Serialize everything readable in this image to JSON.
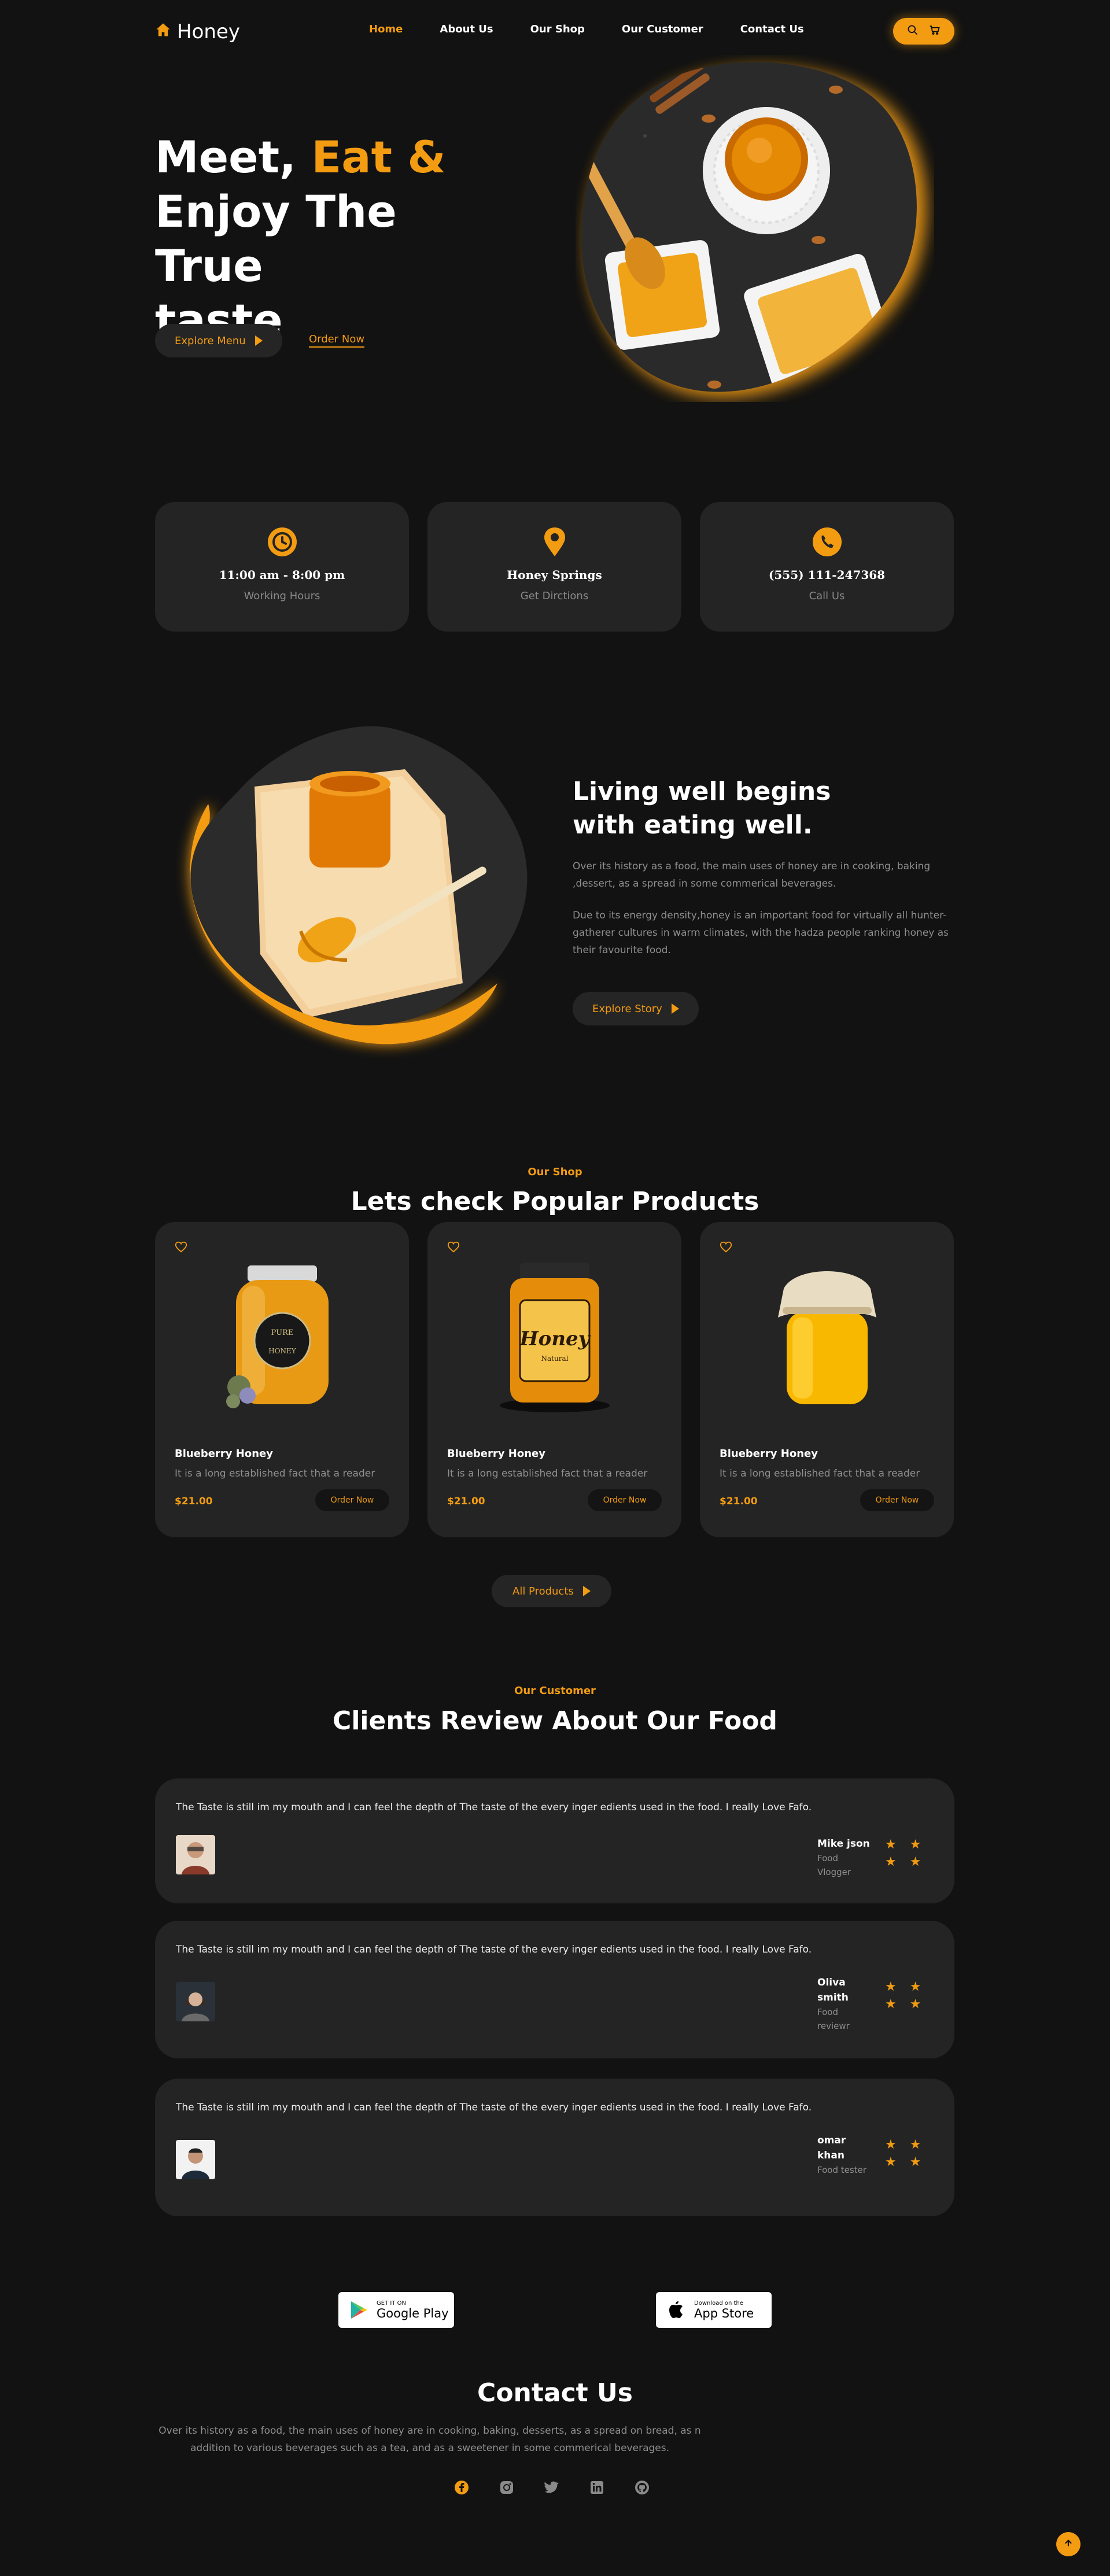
{
  "brand": {
    "name": "Honey",
    "accent": "#f39c12",
    "background": "#121212",
    "card": "#242424"
  },
  "nav": {
    "items": [
      {
        "label": "Home",
        "active": true
      },
      {
        "label": "About Us"
      },
      {
        "label": "Our Shop"
      },
      {
        "label": "Our Customer"
      },
      {
        "label": "Contact Us"
      }
    ],
    "icons": [
      "search-icon",
      "cart-icon"
    ]
  },
  "hero": {
    "title_line1_a": "Meet, ",
    "title_line1_b": "Eat &",
    "title_line2": "Enjoy The True",
    "title_line3": "taste",
    "primary_button": "Explore Menu",
    "secondary_link": "Order Now"
  },
  "info_cards": [
    {
      "icon": "clock-icon",
      "title": "11:00 am - 8:00 pm",
      "subtitle": "Working Hours"
    },
    {
      "icon": "location-pin-icon",
      "title": "Honey Springs",
      "subtitle": "Get Dirctions"
    },
    {
      "icon": "phone-icon",
      "title": "(555) 111-247368",
      "subtitle": "Call Us"
    }
  ],
  "about": {
    "title_line1": "Living well begins",
    "title_line2": "with eating well.",
    "paragraph1": "Over its history as a food, the main uses of honey are in cooking, baking ,dessert, as a spread in some commerical beverages.",
    "paragraph2": "Due to its energy density,honey is an important food for virtually all hunter-gatherer cultures in warm climates, with the hadza people ranking honey as their favourite food.",
    "button": "Explore Story"
  },
  "shop": {
    "kicker": "Our Shop",
    "title": "Lets check Popular Products",
    "products": [
      {
        "name": "Blueberry Honey",
        "desc": "It is a long established fact that a reader",
        "price": "$21.00",
        "button": "Order Now"
      },
      {
        "name": "Blueberry Honey",
        "desc": "It is a long established fact that a reader",
        "price": "$21.00",
        "button": "Order Now"
      },
      {
        "name": "Blueberry Honey",
        "desc": "It is a long established fact that a reader",
        "price": "$21.00",
        "button": "Order Now"
      }
    ],
    "jar_labels": {
      "jar1_top": "PURE",
      "jar1_bottom": "HONEY",
      "jar2_main": "Honey",
      "jar2_sub": "Natural"
    },
    "all_button": "All Products"
  },
  "reviews": {
    "kicker": "Our Customer",
    "title": "Clients Review About Our Food",
    "items": [
      {
        "text": "The Taste is still im my mouth and I can feel the depth of The taste of the every inger edients used in the food. I really Love Fafo.",
        "name": "Mike json",
        "role": "Food Vlogger",
        "stars": "★ ★ ★ ★"
      },
      {
        "text": "The Taste is still im my mouth and I can feel the depth of The taste of the every inger edients used in the food. I really Love Fafo.",
        "name": "Oliva smith",
        "role": "Food reviewr",
        "stars": "★ ★ ★ ★"
      },
      {
        "text": "The Taste is still im my mouth and I can feel the depth of The taste of the every inger edients used in the food. I really Love Fafo.",
        "name": "omar khan",
        "role": "Food tester",
        "stars": "★ ★ ★ ★"
      }
    ]
  },
  "stores": {
    "google": {
      "small": "GET IT ON",
      "big": "Google Play"
    },
    "apple": {
      "small": "Download on the",
      "big": "App Store"
    }
  },
  "contact": {
    "title": "Contact Us",
    "paragraph": "Over its history as a food, the main uses of honey are in cooking, baking, desserts, as a spread on bread, as n addition to various beverages such as a tea, and as a sweetener in some commerical beverages.",
    "socials": [
      "facebook-icon",
      "instagram-icon",
      "twitter-icon",
      "linkedin-icon",
      "github-icon"
    ]
  }
}
